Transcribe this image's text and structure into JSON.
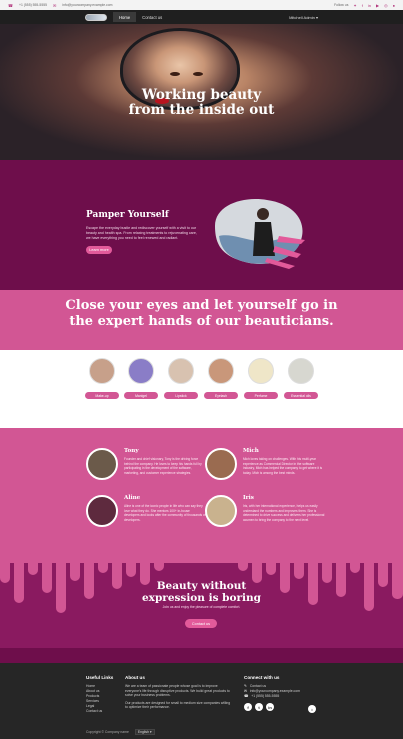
{
  "topbar": {
    "phone": "+1 (555) 555-5555",
    "email": "info@yourcompany.example.com",
    "follow_label": "Follow us",
    "social_icons": [
      "twitter-icon",
      "facebook-icon",
      "linkedin-icon",
      "youtube-icon",
      "instagram-icon",
      "github-icon"
    ]
  },
  "header": {
    "nav": [
      "Home",
      "Contact us"
    ],
    "user": "Mitchell Admin"
  },
  "hero": {
    "title_line1": "Working beauty",
    "title_line2": "from the inside out"
  },
  "pamper": {
    "title": "Pamper Yourself",
    "text": "Escape the everyday bustle and rediscover yourself with a visit to our beauty and health spa. From relaxing treatments to rejuvenating care, we have everything you need to feel renewed and radiant.",
    "button": "Learn more"
  },
  "quote": {
    "line1": "Close your eyes and let yourself go in",
    "line2": "the expert hands of our beauticians."
  },
  "services": [
    {
      "label": "Make-up",
      "color": "#c7a08a"
    },
    {
      "label": "Manigel",
      "color": "#8a7dc7"
    },
    {
      "label": "Lipstick",
      "color": "#d8c2b0"
    },
    {
      "label": "Eyelash",
      "color": "#c9977a"
    },
    {
      "label": "Perfume",
      "color": "#efe6c8"
    },
    {
      "label": "Essential oils",
      "color": "#d7d7d0"
    }
  ],
  "team": [
    {
      "name": "Tony",
      "text": "Founder and chief visionary, Tony is the driving force behind the company. He loves to keep his hands full by participating in the development of the software, marketing, and customer experience strategies.",
      "avatar_color": "#6b5a4a"
    },
    {
      "name": "Mich",
      "text": "Mich loves taking on challenges. With his multi-year experience as Commercial Director in the software industry, Mich has helped the company to get where it is today. Mich is among the best minds.",
      "avatar_color": "#9a6b50"
    },
    {
      "name": "Aline",
      "text": "Aline is one of the iconic people in life who can say they love what they do. She mentors 100+ in-house developers and looks after the community of thousands of developers.",
      "avatar_color": "#5e2a3e"
    },
    {
      "name": "Iris",
      "text": "Iris, with her international experience, helps us easily understand the numbers and improves them. She is determined to drive success and delivers her professional acumen to bring the company to the next level.",
      "avatar_color": "#c9b28e"
    }
  ],
  "cta": {
    "title_line1": "Beauty without",
    "title_line2": "expression is boring",
    "subtitle": "Join us and enjoy the pleasure of complete comfort.",
    "button": "Contact us"
  },
  "footer": {
    "links_title": "Useful Links",
    "links": [
      "Home",
      "About us",
      "Products",
      "Services",
      "Legal",
      "Contact us"
    ],
    "about_title": "About us",
    "about_text1": "We are a team of passionate people whose goal is to improve everyone's life through disruptive products. We build great products to solve your business problems.",
    "about_text2": "Our products are designed for small to medium size companies willing to optimize their performance.",
    "contact_title": "Connect with us",
    "contact_rows": [
      "Contact us",
      "info@yourcompany.example.com",
      "+1 (555) 555-5555"
    ],
    "socials": [
      "f",
      "t",
      "in"
    ],
    "copyright": "Copyright © Company name",
    "language": "English"
  }
}
